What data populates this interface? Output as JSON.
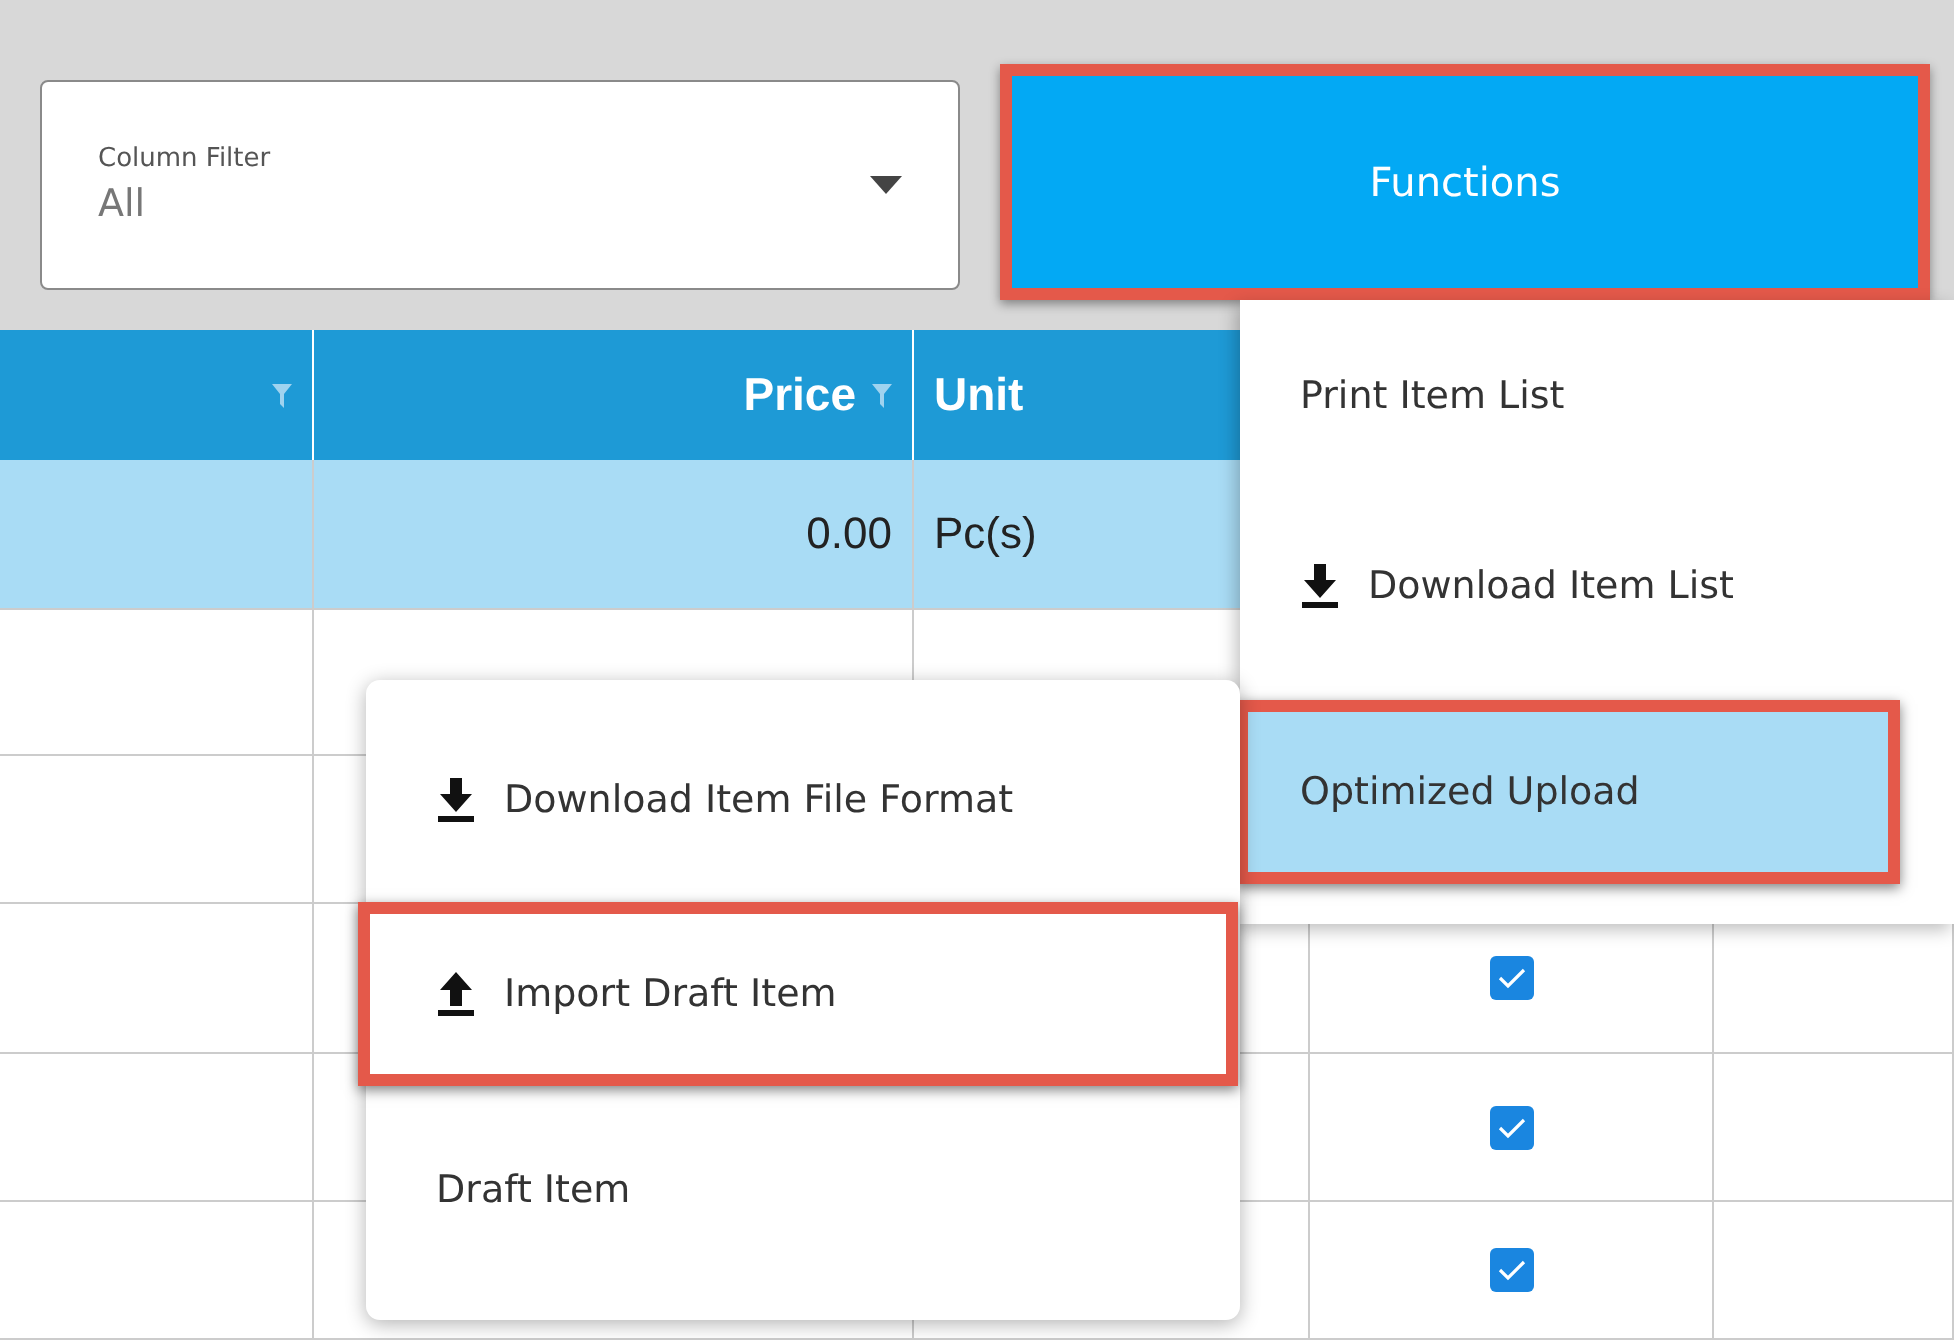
{
  "column_filter": {
    "label": "Column Filter",
    "value": "All"
  },
  "functions_button": {
    "label": "Functions",
    "highlighted": true
  },
  "table": {
    "columns": [
      {
        "filter": true
      },
      {
        "label": "Price",
        "filter": true
      },
      {
        "label": "Unit",
        "filter": false
      }
    ],
    "rows": [
      {
        "price": "0.00",
        "unit": "Pc(s)",
        "selected": true
      },
      {
        "selected": false
      },
      {
        "selected": false
      },
      {
        "selected": false,
        "checked": true
      },
      {
        "selected": false,
        "checked": true
      },
      {
        "selected": false,
        "checked": true
      }
    ]
  },
  "functions_menu": [
    {
      "label": "Print Item List",
      "kind": "plain",
      "highlighted": false,
      "selected": false
    },
    {
      "label": "Download Item List",
      "kind": "download",
      "highlighted": false,
      "selected": false
    },
    {
      "label": "Optimized Upload",
      "kind": "plain",
      "highlighted": true,
      "selected": true
    }
  ],
  "submenu": [
    {
      "label": "Download Item File Format",
      "kind": "download",
      "highlighted": false
    },
    {
      "label": "Import Draft Item",
      "kind": "upload",
      "highlighted": true
    },
    {
      "label": "Draft Item",
      "kind": "plain",
      "highlighted": false
    }
  ]
}
